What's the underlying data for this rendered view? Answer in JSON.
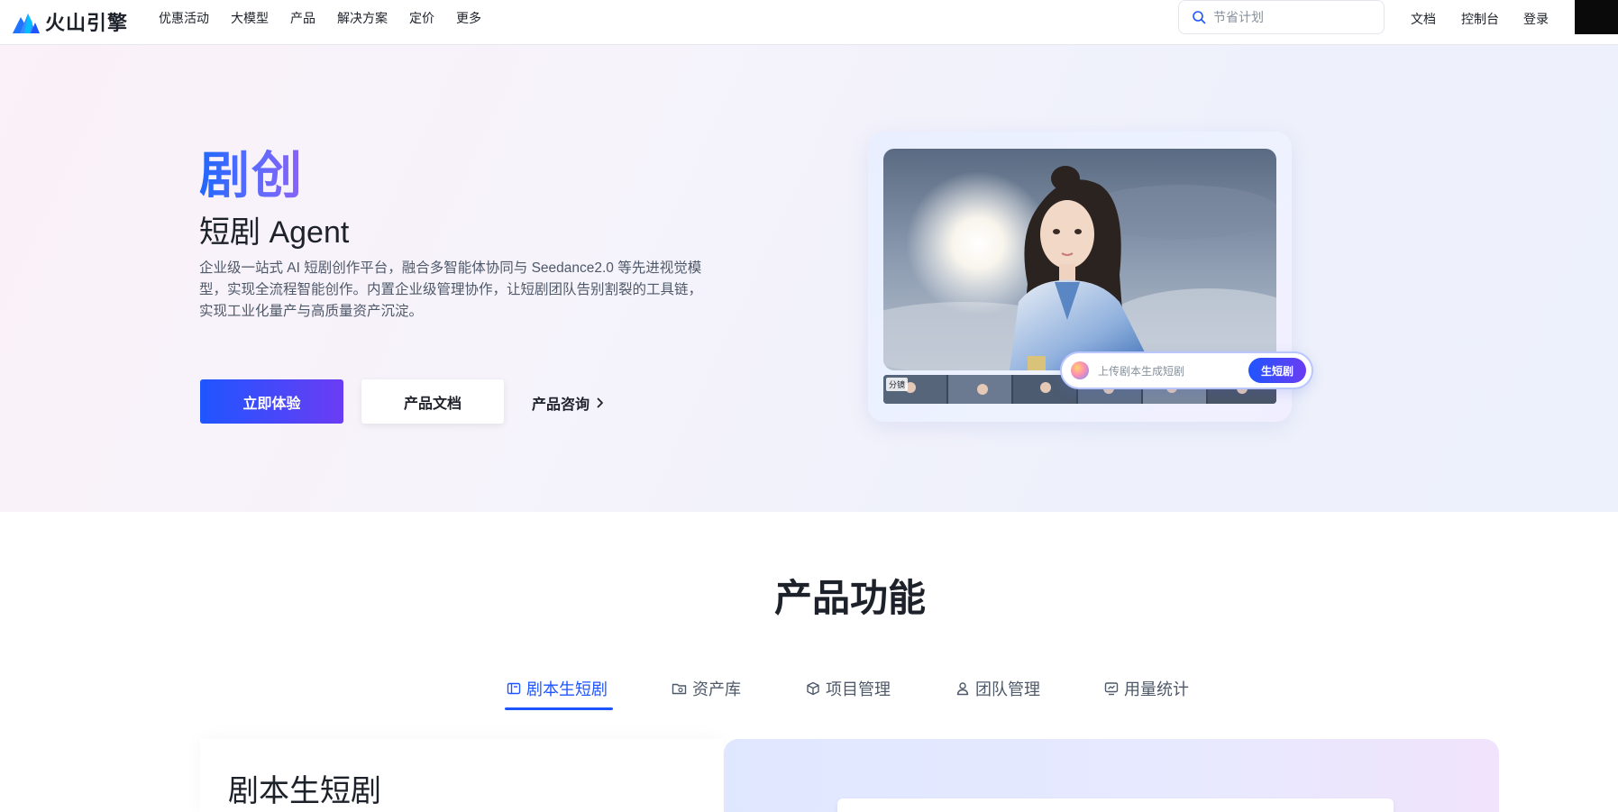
{
  "header": {
    "logo_text": "火山引擎",
    "nav": [
      "优惠活动",
      "大模型",
      "产品",
      "解决方案",
      "定价",
      "更多"
    ],
    "search_placeholder": "节省计划",
    "links": {
      "docs": "文档",
      "console": "控制台",
      "login": "登录"
    }
  },
  "hero": {
    "title": "剧创",
    "subtitle": "短剧 Agent",
    "description": "企业级一站式 AI 短剧创作平台，融合多智能体协同与 Seedance2.0 等先进视觉模型，实现全流程智能创作。内置企业级管理协作，让短剧团队告别割裂的工具链，实现工业化量产与高质量资产沉淀。",
    "buttons": {
      "primary": "立即体验",
      "secondary": "产品文档",
      "link": "产品咨询"
    },
    "visual": {
      "strip_label": "分镜",
      "input_placeholder": "上传剧本生成短剧",
      "generate_button": "生短剧"
    }
  },
  "features": {
    "title": "产品功能",
    "tabs": [
      {
        "label": "剧本生短剧",
        "icon": "script-icon",
        "active": true
      },
      {
        "label": "资产库",
        "icon": "asset-folder-icon",
        "active": false
      },
      {
        "label": "项目管理",
        "icon": "cube-icon",
        "active": false
      },
      {
        "label": "团队管理",
        "icon": "user-icon",
        "active": false
      },
      {
        "label": "用量统计",
        "icon": "monitor-chart-icon",
        "active": false
      }
    ],
    "panel_title": "剧本生短剧"
  },
  "colors": {
    "primary": "#1f55ff",
    "accent": "#6b3cf3",
    "text": "#1d2129",
    "muted": "#4e5969"
  }
}
